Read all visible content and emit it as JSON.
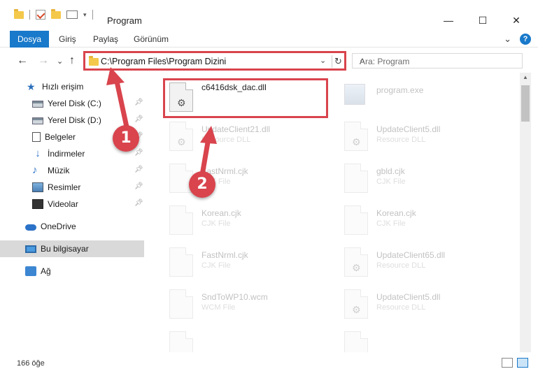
{
  "window": {
    "title": "Program",
    "minimize": "—",
    "maximize": "☐",
    "close": "✕"
  },
  "ribbon": {
    "tabs": [
      "Dosya",
      "Giriş",
      "Paylaş",
      "Görünüm"
    ],
    "expand": "⌄",
    "help": "?"
  },
  "nav": {
    "back": "←",
    "forward": "→",
    "recent": "⌄",
    "up": "↑",
    "address": "C:\\Program Files\\Program Dizini",
    "address_chevron": "⌄",
    "refresh": "↻",
    "search_placeholder": "Ara: Program",
    "search_icon": "⌕"
  },
  "sidebar": {
    "items": [
      {
        "label": "Hızlı erişim",
        "icon": "star-icon"
      },
      {
        "label": "Yerel Disk (C:)",
        "icon": "drive-icon"
      },
      {
        "label": "Yerel Disk (D:)",
        "icon": "drive-icon"
      },
      {
        "label": "Belgeler",
        "icon": "documents-icon"
      },
      {
        "label": "İndirmeler",
        "icon": "download-icon"
      },
      {
        "label": "Müzik",
        "icon": "music-icon"
      },
      {
        "label": "Resimler",
        "icon": "pictures-icon"
      },
      {
        "label": "Videolar",
        "icon": "videos-icon"
      },
      {
        "label": "OneDrive",
        "icon": "cloud-icon"
      },
      {
        "label": "Bu bilgisayar",
        "icon": "computer-icon"
      },
      {
        "label": "Ağ",
        "icon": "network-icon"
      }
    ]
  },
  "files": [
    {
      "name": "c6416dsk_dac.dll",
      "type": ""
    },
    {
      "name": "program.exe",
      "type": ""
    },
    {
      "name": "UpdateClient21.dll",
      "type": "Resource DLL"
    },
    {
      "name": "UpdateClient5.dll",
      "type": "Resource DLL"
    },
    {
      "name": "FastNrml.cjk",
      "type": "CJK File"
    },
    {
      "name": "gbld.cjk",
      "type": "CJK File"
    },
    {
      "name": "Korean.cjk",
      "type": "CJK File"
    },
    {
      "name": "Korean.cjk",
      "type": "CJK File"
    },
    {
      "name": "FastNrml.cjk",
      "type": "CJK File"
    },
    {
      "name": "UpdateClient65.dll",
      "type": "Resource DLL"
    },
    {
      "name": "SndToWP10.wcm",
      "type": "WCM File"
    },
    {
      "name": "UpdateClient5.dll",
      "type": "Resource DLL"
    }
  ],
  "status": {
    "count": "166 öğe"
  },
  "annotations": {
    "badge1": "1",
    "badge2": "2",
    "color": "#d9444d"
  },
  "colors": {
    "accent": "#1979ca",
    "highlight": "#d9444d"
  }
}
